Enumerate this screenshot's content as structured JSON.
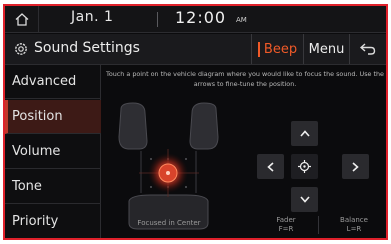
{
  "status_bar": {
    "home_icon": "home-icon",
    "date": "Jan. 1",
    "time": "12:00",
    "ampm": "AM"
  },
  "title_bar": {
    "icon": "gear-icon",
    "title": "Sound Settings",
    "beep_label": "Beep",
    "menu_label": "Menu",
    "back_icon": "back-arrow-icon"
  },
  "sidebar": {
    "items": [
      {
        "label": "Advanced",
        "active": false
      },
      {
        "label": "Position",
        "active": true
      },
      {
        "label": "Volume",
        "active": false
      },
      {
        "label": "Tone",
        "active": false
      },
      {
        "label": "Priority",
        "active": false
      }
    ]
  },
  "main": {
    "instructions": "Touch a point on the vehicle diagram where you would like to focus the sound. Use the arrows to fine-tune the position.",
    "diagram_label": "Focused in Center",
    "fader_label": "Fader",
    "fader_value": "F=R",
    "balance_label": "Balance",
    "balance_value": "L=R"
  },
  "colors": {
    "accent": "#f05a28",
    "highlight_border": "#e0212b",
    "active_item_bg": "#3d1a16",
    "focus_point": "#d8432b"
  }
}
